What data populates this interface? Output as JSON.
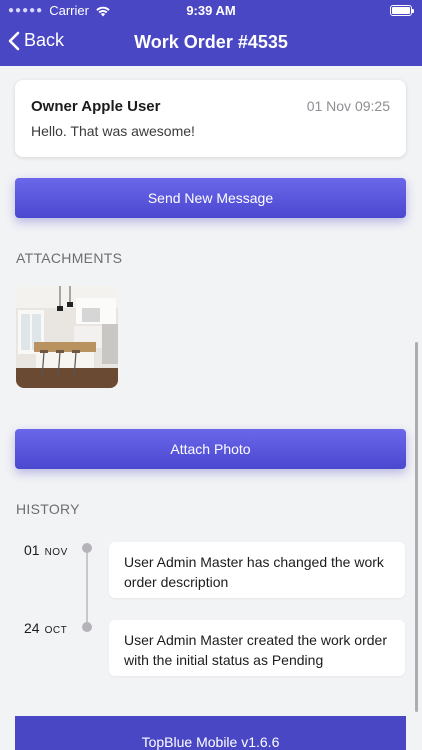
{
  "status_bar": {
    "carrier": "Carrier",
    "time": "9:39 AM"
  },
  "nav": {
    "back_label": "Back",
    "title": "Work Order #4535"
  },
  "message": {
    "author": "Owner Apple User",
    "timestamp": "01 Nov 09:25",
    "text": "Hello. That was awesome!"
  },
  "buttons": {
    "send_message": "Send New Message",
    "attach_photo": "Attach Photo"
  },
  "attachments": {
    "heading": "ATTACHMENTS"
  },
  "history": {
    "heading": "HISTORY",
    "items": [
      {
        "day": "01",
        "month": "NOV",
        "text": "User Admin Master has changed the work order description"
      },
      {
        "day": "24",
        "month": "OCT",
        "text": "User Admin Master created the work order with the initial status as Pending"
      }
    ]
  },
  "footer": {
    "text": "TopBlue Mobile v1.6.6"
  },
  "colors": {
    "accent": "#4a47c4",
    "button_top": "#6a67ea",
    "background": "#f2f3f5"
  }
}
